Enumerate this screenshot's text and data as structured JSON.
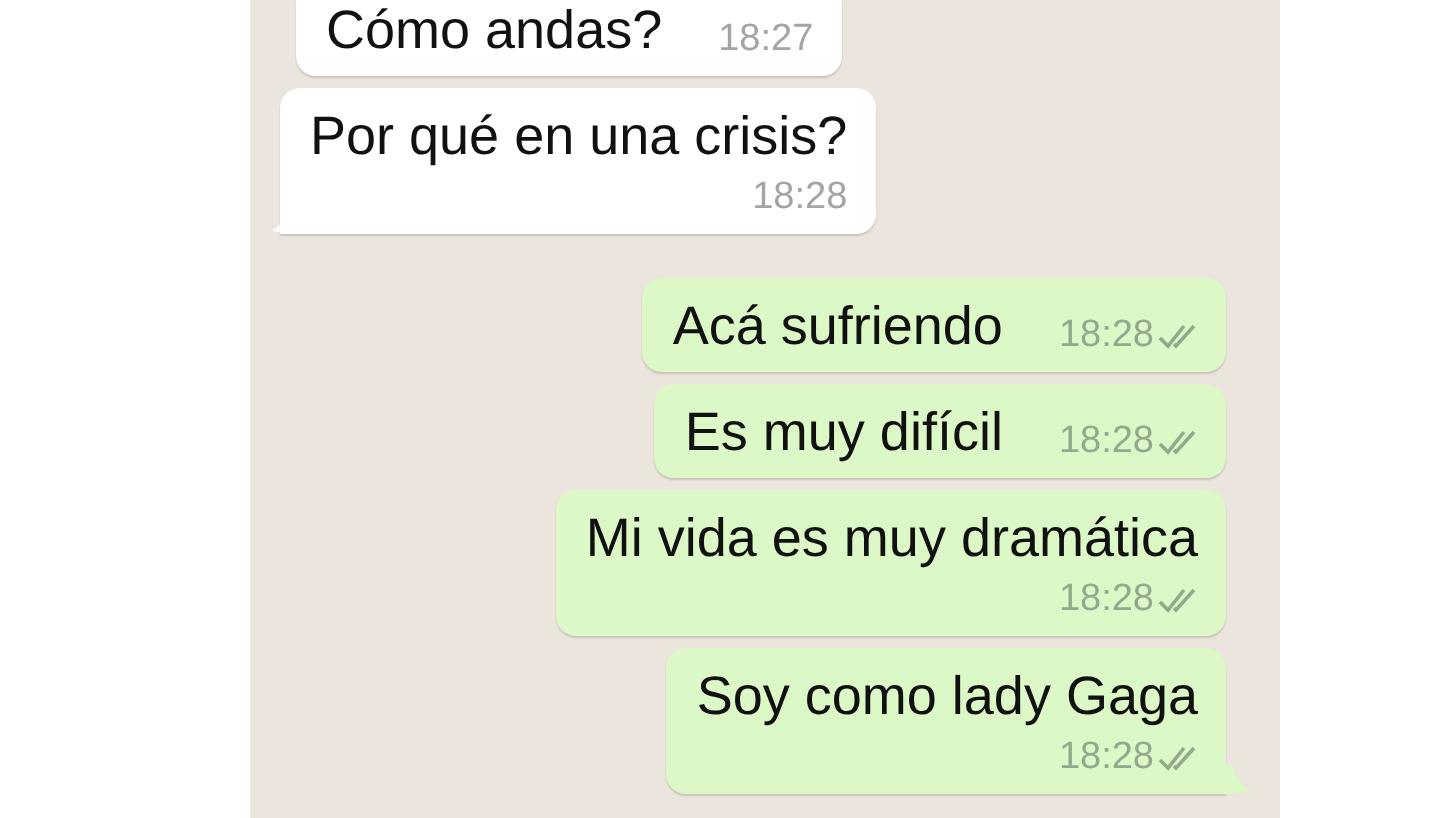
{
  "messages": [
    {
      "outgoing": false,
      "kind": "inline",
      "tail": false,
      "text": "Cómo andas?",
      "time": "18:27"
    },
    {
      "outgoing": false,
      "kind": "stacked",
      "tail": true,
      "text": "Por qué en una crisis?",
      "time": "18:28"
    },
    {
      "outgoing": true,
      "kind": "inline",
      "tail": false,
      "text": "Acá sufriendo",
      "time": "18:28",
      "delivered": true
    },
    {
      "outgoing": true,
      "kind": "inline",
      "tail": false,
      "text": "Es muy difícil",
      "time": "18:28",
      "delivered": true
    },
    {
      "outgoing": true,
      "kind": "stacked",
      "tail": false,
      "text": "Mi vida es muy dramática",
      "time": "18:28",
      "delivered": true
    },
    {
      "outgoing": true,
      "kind": "stacked",
      "tail": true,
      "text": "Soy como lady Gaga",
      "time": "18:28",
      "delivered": true
    }
  ]
}
